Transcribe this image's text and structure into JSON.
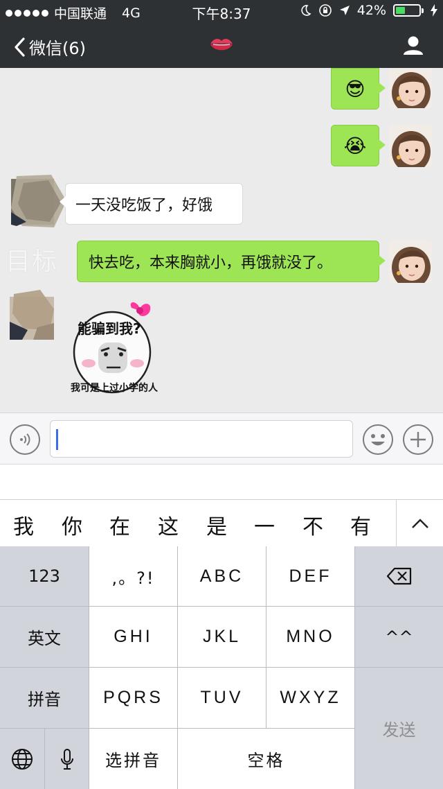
{
  "status_bar": {
    "carrier": "中国联通",
    "network": "4G",
    "time": "下午8:37",
    "battery": "42%",
    "battery_level": 0.42
  },
  "nav": {
    "back_label": "微信(6)",
    "title_icon": "lips-icon",
    "profile_icon": "person-icon"
  },
  "messages": [
    {
      "side": "right",
      "type": "emoji",
      "emoji": "😎"
    },
    {
      "side": "right",
      "type": "emoji",
      "emoji": "😭"
    },
    {
      "side": "left",
      "type": "text",
      "text": "一天没吃饭了，好饿"
    },
    {
      "side": "right",
      "type": "text",
      "text": "快去吃，本来胸就小，再饿就没了。"
    },
    {
      "side": "left",
      "type": "sticker",
      "top_text": "能骗到我?",
      "bottom_text": "我可是上过小学的人"
    }
  ],
  "watermark": "目标",
  "input": {
    "voice_icon": "voice-icon",
    "emoji_icon": "smiley-icon",
    "plus_icon": "plus-icon",
    "value": ""
  },
  "candidates": [
    "我",
    "你",
    "在",
    "这",
    "是",
    "一",
    "不",
    "有"
  ],
  "keyboard": {
    "row1": [
      "123",
      ",。?!",
      "ABC",
      "DEF"
    ],
    "row2": [
      "英文",
      "GHI",
      "JKL",
      "MNO",
      "^^"
    ],
    "row3": [
      "拼音",
      "PQRS",
      "TUV",
      "WXYZ"
    ],
    "row4": [
      "选拼音",
      "空格"
    ],
    "send": "发送",
    "delete_icon": "backspace-icon",
    "globe_icon": "globe-icon",
    "mic_icon": "mic-icon"
  },
  "colors": {
    "topbar": "#2e3134",
    "bubble_green": "#9ee555",
    "chat_bg": "#ebebeb",
    "caret": "#3a6ee8"
  }
}
